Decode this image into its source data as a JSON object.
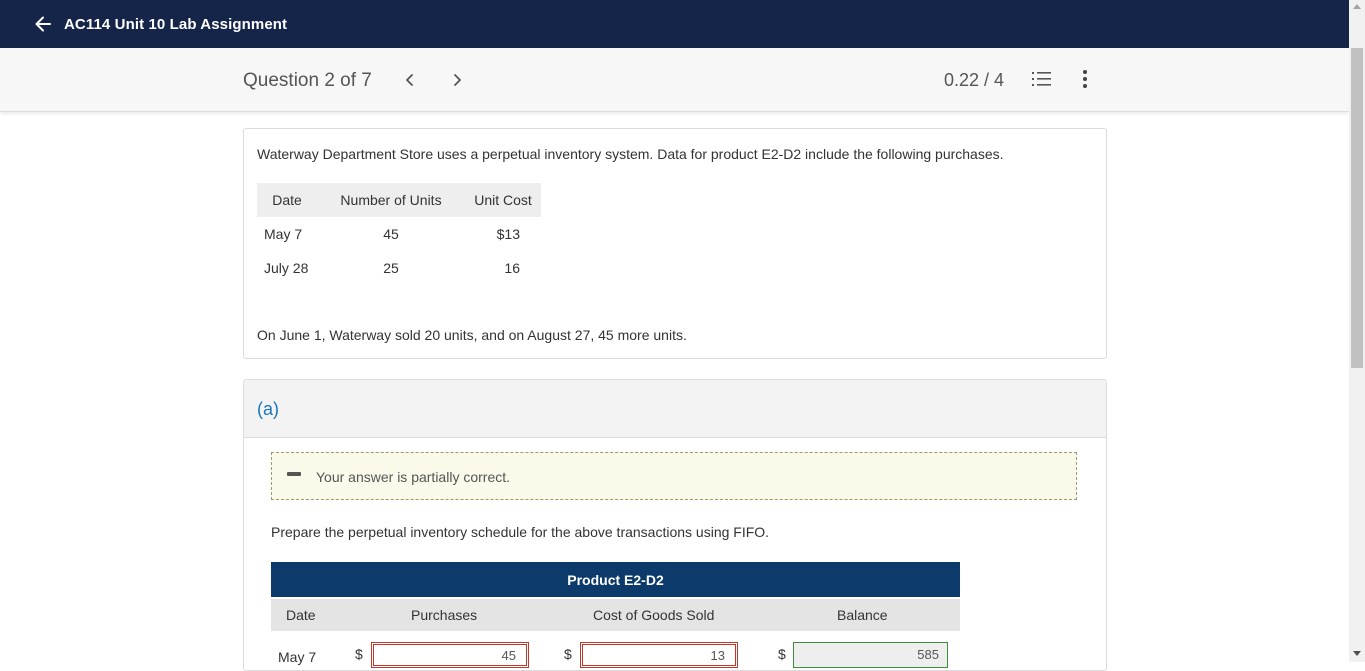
{
  "header": {
    "title": "AC114 Unit 10 Lab Assignment"
  },
  "question_bar": {
    "label": "Question 2 of 7",
    "score": "0.22 / 4"
  },
  "question": {
    "intro": "Waterway Department Store uses a perpetual inventory system. Data for product E2-D2 include the following purchases.",
    "table": {
      "headers": [
        "Date",
        "Number of Units",
        "Unit Cost"
      ],
      "rows": [
        [
          "May 7",
          "45",
          "$13"
        ],
        [
          "July 28",
          "25",
          "16"
        ]
      ]
    },
    "after": "On June 1, Waterway sold 20 units, and on August 27, 45 more units."
  },
  "part_a": {
    "label": "(a)",
    "feedback": "Your answer is partially correct.",
    "instruction": "Prepare the perpetual inventory schedule for the above transactions using FIFO.",
    "schedule": {
      "title": "Product E2-D2",
      "columns": [
        "Date",
        "Purchases",
        "Cost of Goods Sold",
        "Balance"
      ],
      "row": {
        "date": "May 7",
        "dollar1": "$",
        "purchases": "45",
        "dollar2": "$",
        "cogs": "13",
        "dollar3": "$",
        "balance": "585"
      }
    }
  },
  "colors": {
    "header_bg": "#15254a",
    "schedule_header": "#0b3a6b",
    "part_label": "#1a75bb",
    "incorrect_border": "#c0392b",
    "correct_border": "#3c8d3c"
  }
}
